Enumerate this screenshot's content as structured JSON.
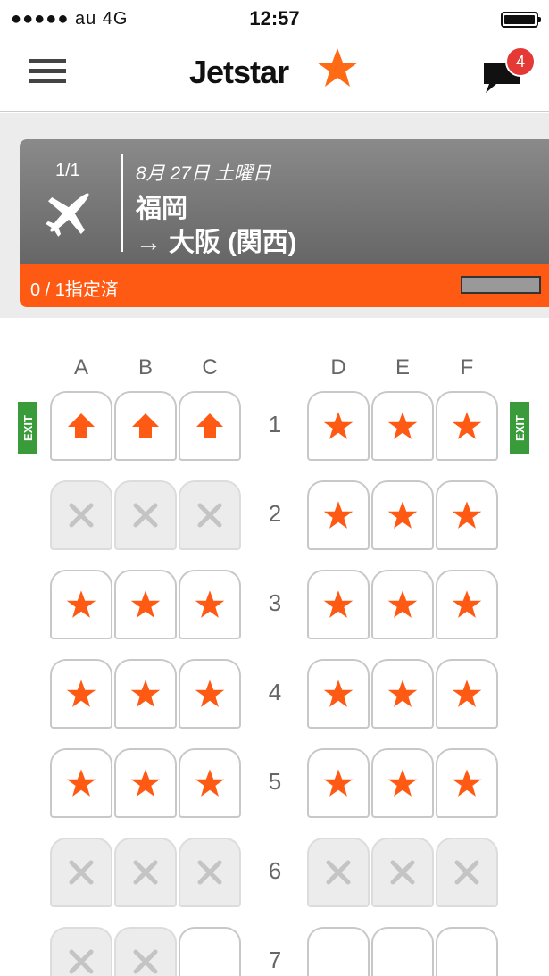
{
  "status": {
    "carrier": "●●●●● au  4G",
    "time": "12:57"
  },
  "header": {
    "logo_text": "Jetstar",
    "notification_count": "4"
  },
  "flight": {
    "index": "1/1",
    "date": "8月 27日 土曜日",
    "origin": "福岡",
    "destination": "→ 大阪 (関西)",
    "assigned": "0 / 1指定済"
  },
  "colors": {
    "brand_orange": "#ff5a14",
    "exit_green": "#3a9b3a"
  },
  "seatmap": {
    "columns": [
      "A",
      "B",
      "C",
      "D",
      "E",
      "F"
    ],
    "exit_label": "EXIT",
    "rows": [
      {
        "num": "1",
        "seats": [
          "upfront",
          "upfront",
          "upfront",
          "star",
          "star",
          "star"
        ],
        "exit": true
      },
      {
        "num": "2",
        "seats": [
          "blocked",
          "blocked",
          "blocked",
          "star",
          "star",
          "star"
        ],
        "exit": false
      },
      {
        "num": "3",
        "seats": [
          "star",
          "star",
          "star",
          "star",
          "star",
          "star"
        ],
        "exit": false
      },
      {
        "num": "4",
        "seats": [
          "star",
          "star",
          "star",
          "star",
          "star",
          "star"
        ],
        "exit": false
      },
      {
        "num": "5",
        "seats": [
          "star",
          "star",
          "star",
          "star",
          "star",
          "star"
        ],
        "exit": false
      },
      {
        "num": "6",
        "seats": [
          "blocked",
          "blocked",
          "blocked",
          "blocked",
          "blocked",
          "blocked"
        ],
        "exit": false
      },
      {
        "num": "7",
        "seats": [
          "blocked",
          "blocked",
          "empty",
          "empty",
          "empty",
          "empty"
        ],
        "exit": false
      }
    ]
  }
}
